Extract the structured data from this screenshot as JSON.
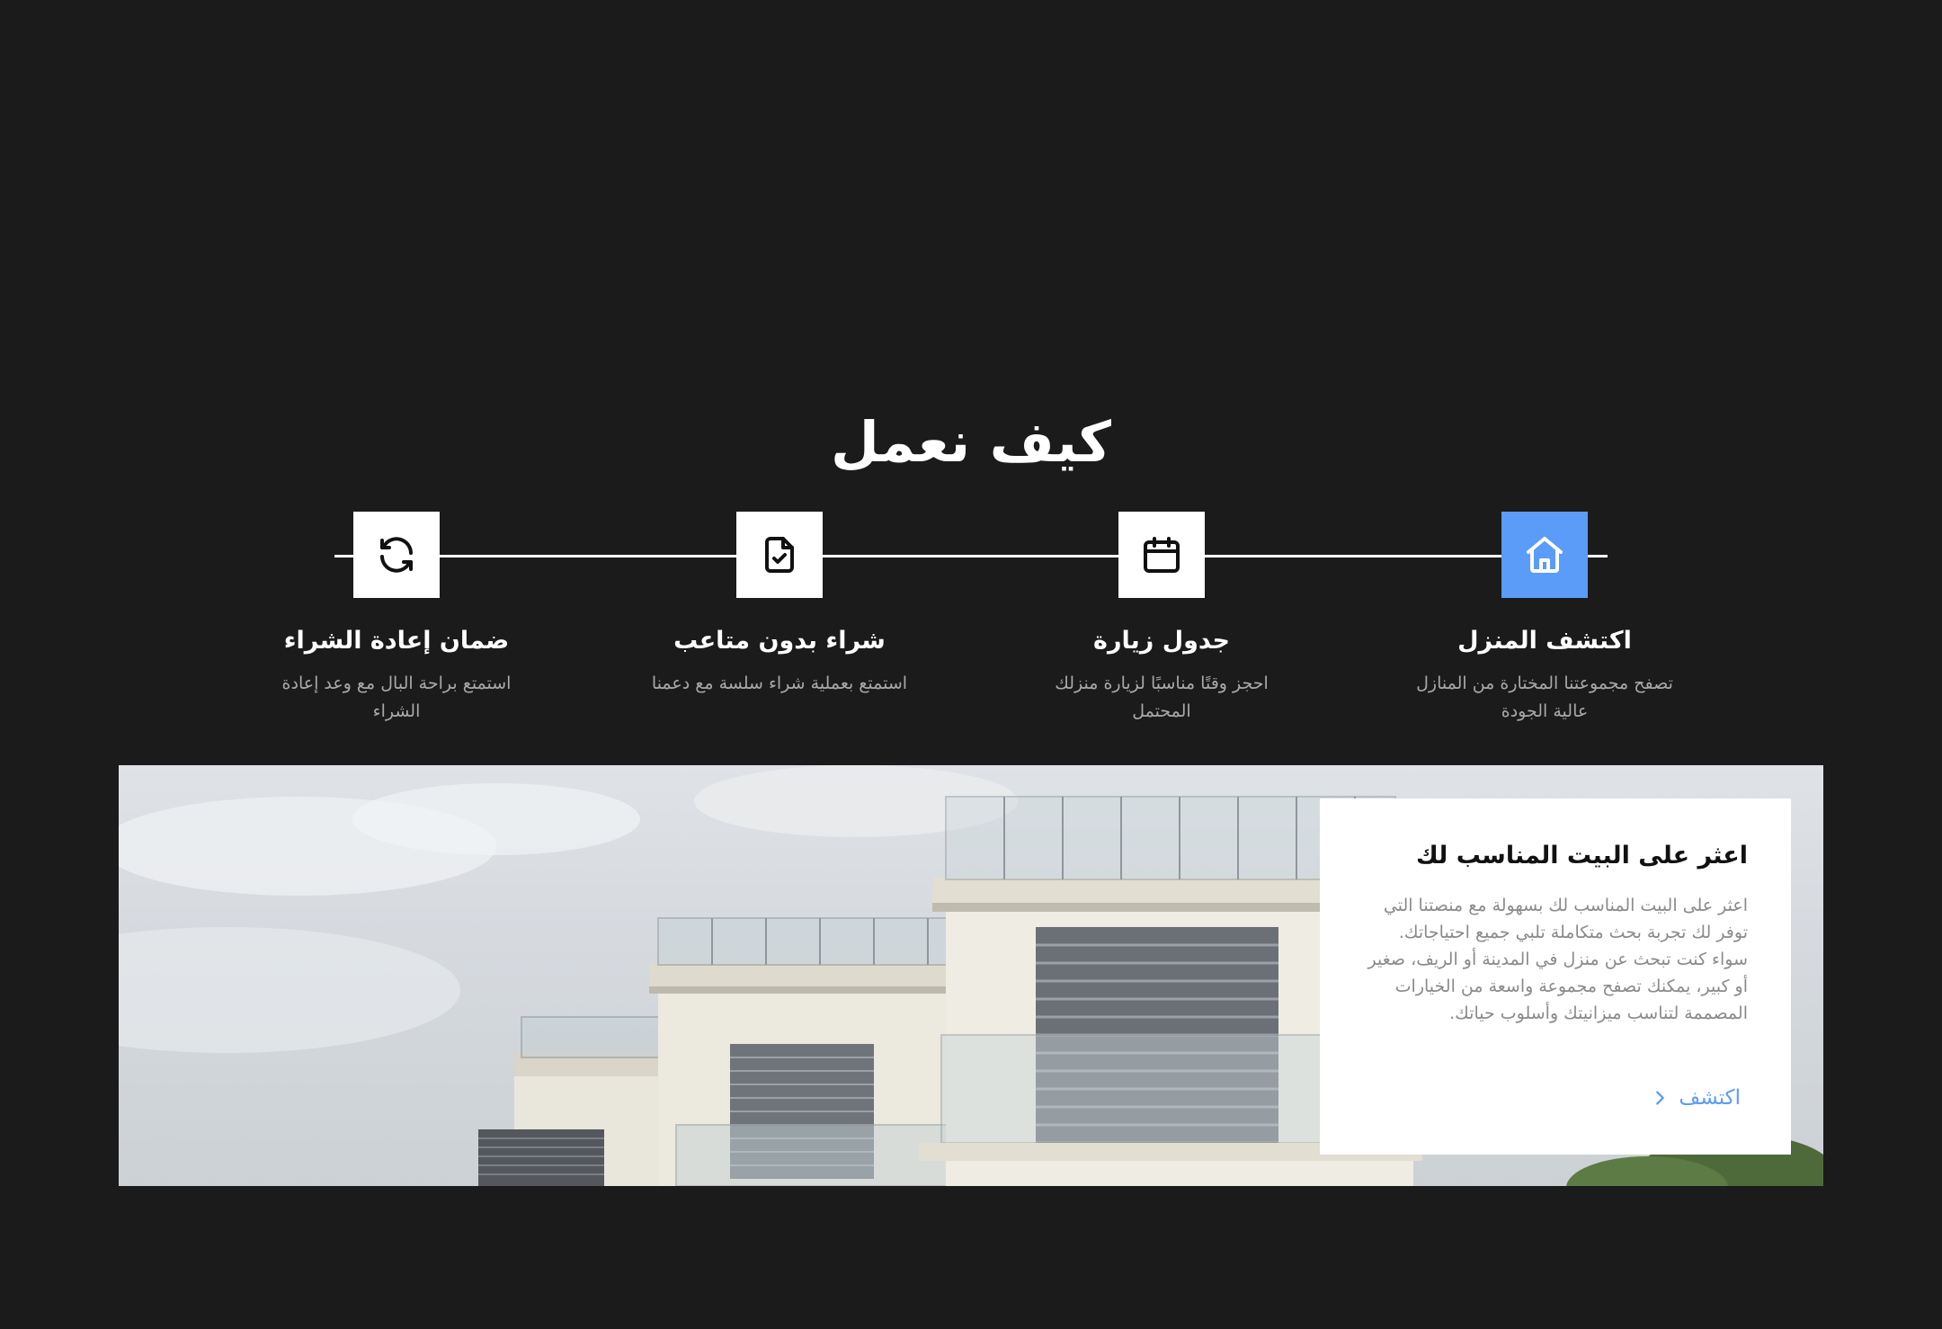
{
  "section": {
    "title": "كيف نعمل"
  },
  "steps": [
    {
      "title": "اكتشف المنزل",
      "description": "تصفح مجموعتنا المختارة من المنازل عالية الجودة",
      "icon": "home-icon",
      "active": true
    },
    {
      "title": "جدول زيارة",
      "description": "احجز وقتًا مناسبًا لزيارة منزلك المحتمل",
      "icon": "calendar-icon",
      "active": false
    },
    {
      "title": "شراء بدون متاعب",
      "description": "استمتع بعملية شراء سلسة مع دعمنا",
      "icon": "file-check-icon",
      "active": false
    },
    {
      "title": "ضمان إعادة الشراء",
      "description": "استمتع براحة البال مع وعد إعادة الشراء",
      "icon": "refresh-icon",
      "active": false
    }
  ],
  "card": {
    "title": "اعثر على البيت المناسب لك",
    "text": "اعثر على البيت المناسب لك بسهولة مع منصتنا التي توفر لك تجربة بحث متكاملة تلبي جميع احتياجاتك. سواء كنت تبحث عن منزل في المدينة أو الريف، صغير أو كبير، يمكنك تصفح مجموعة واسعة من الخيارات المصممة لتناسب ميزانيتك وأسلوب حياتك.",
    "link_label": "اكتشف"
  },
  "colors": {
    "background": "#1b1b1b",
    "accent": "#5a9cf8",
    "text_light": "#ffffff",
    "text_muted": "#a9a9a9"
  }
}
